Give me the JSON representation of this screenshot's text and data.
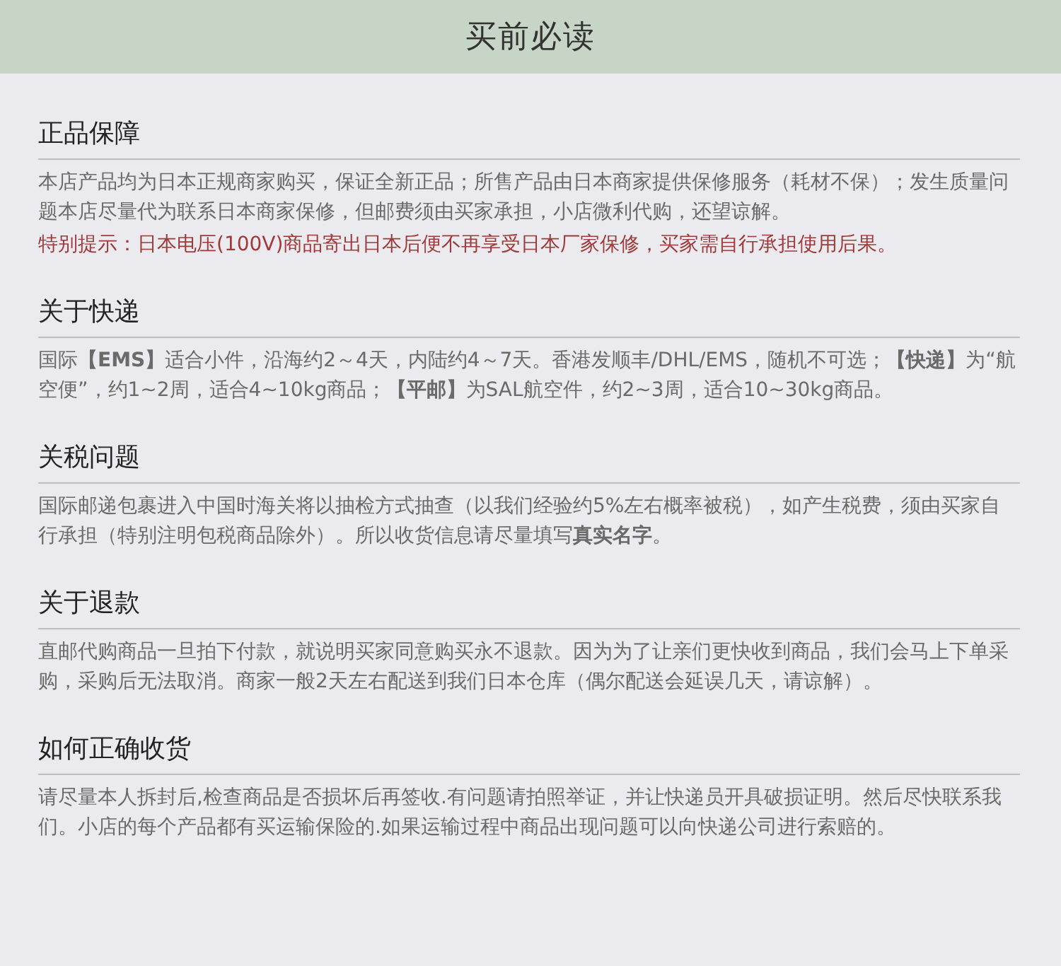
{
  "header": {
    "title": "买前必读"
  },
  "sections": [
    {
      "heading": "正品保障",
      "paragraphs": [
        {
          "kind": "normal",
          "text": "本店产品均为日本正规商家购买，保证全新正品；所售产品由日本商家提供保修服务（耗材不保）；发生质量问题本店尽量代为联系日本商家保修，但邮费须由买家承担，小店微利代购，还望谅解。"
        },
        {
          "kind": "warning",
          "text": "特别提示：日本电压(100V)商品寄出日本后便不再享受日本厂家保修，买家需自行承担使用后果。"
        }
      ]
    },
    {
      "heading": "关于快递",
      "paragraphs": [
        {
          "kind": "normal",
          "text": "国际**【EMS】**适合小件，沿海约2～4天，内陆约4～7天。香港发顺丰/DHL/EMS，随机不可选；**【快递】**为“航空便”，约1~2周，适合4~10kg商品；**【平邮】**为SAL航空件，约2~3周，适合10~30kg商品。"
        }
      ]
    },
    {
      "heading": "关税问题",
      "paragraphs": [
        {
          "kind": "normal",
          "text": "国际邮递包裹进入中国时海关将以抽检方式抽查（以我们经验约5%左右概率被税），如产生税费，须由买家自行承担（特别注明包税商品除外）。所以收货信息请尽量填写**真实名字**。"
        }
      ]
    },
    {
      "heading": "关于退款",
      "paragraphs": [
        {
          "kind": "normal",
          "text": "直邮代购商品一旦拍下付款，就说明买家同意购买永不退款。因为为了让亲们更快收到商品，我们会马上下单采购，采购后无法取消。商家一般2天左右配送到我们日本仓库（偶尔配送会延误几天，请谅解）。"
        }
      ]
    },
    {
      "heading": "如何正确收货",
      "paragraphs": [
        {
          "kind": "normal",
          "text": "请尽量本人拆封后,检查商品是否损坏后再签收.有问题请拍照举证，并让快递员开具破损证明。然后尽快联系我们。小店的每个产品都有买运输保险的.如果运输过程中商品出现问题可以向快递公司进行索赔的。"
        }
      ]
    }
  ]
}
